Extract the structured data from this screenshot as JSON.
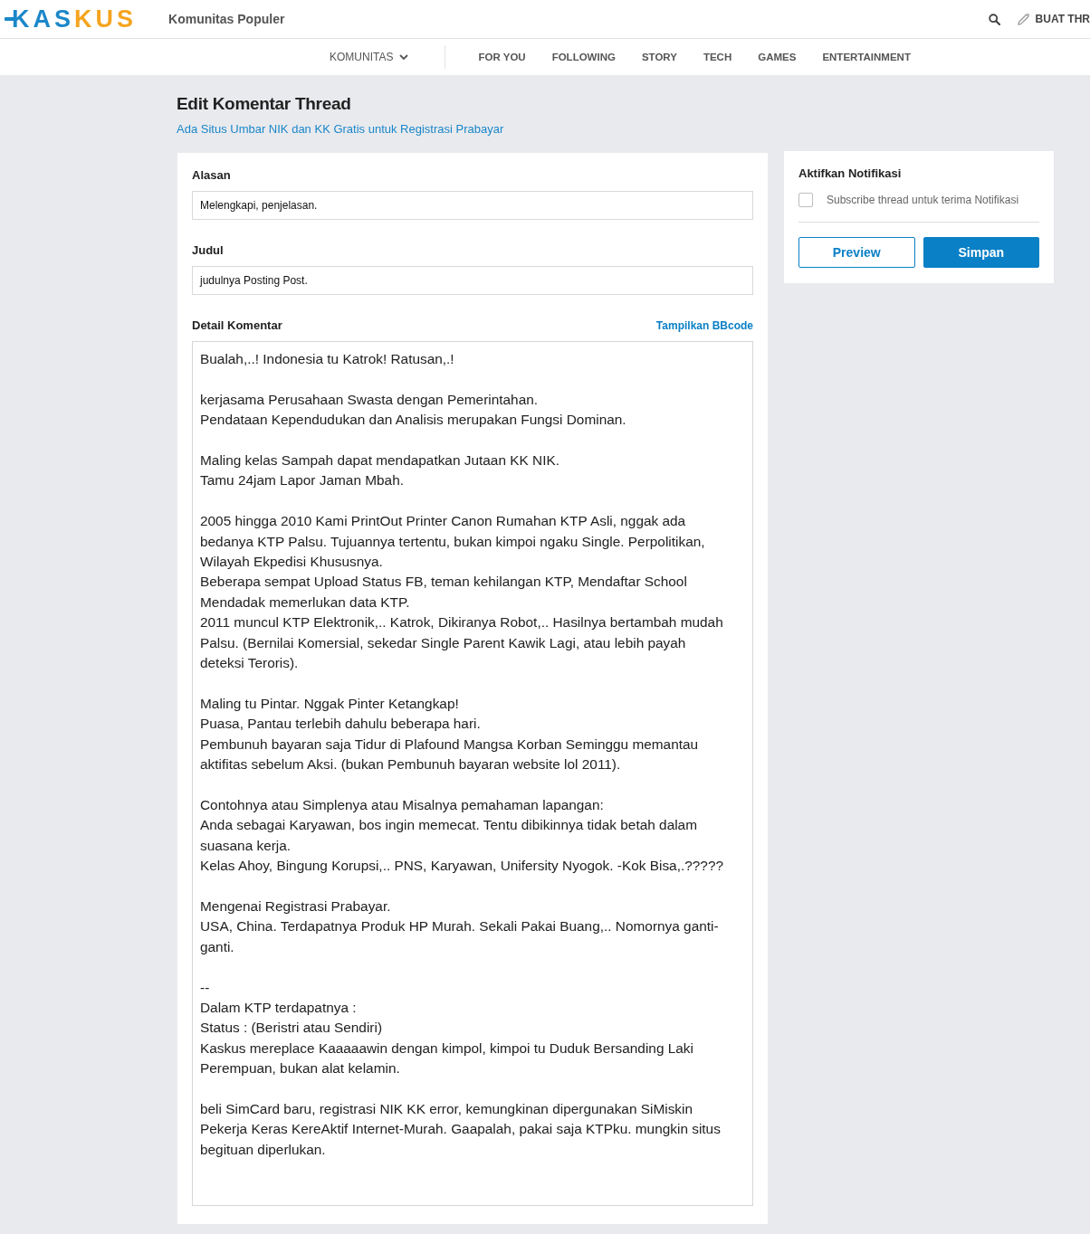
{
  "header": {
    "logo": {
      "text": "KASKUS"
    },
    "section_title": "Komunitas Populer",
    "create_button": {
      "label": "BUAT THR"
    }
  },
  "nav": {
    "community_menu": {
      "label": "KOMUNITAS",
      "expanded": false
    },
    "tabs": [
      {
        "label": "FOR YOU",
        "selected": false
      },
      {
        "label": "FOLLOWING",
        "selected": false
      },
      {
        "label": "STORY",
        "selected": false
      },
      {
        "label": "TECH",
        "selected": false
      },
      {
        "label": "GAMES",
        "selected": false
      },
      {
        "label": "ENTERTAINMENT",
        "selected": false
      }
    ]
  },
  "page": {
    "title": "Edit Komentar Thread",
    "thread_link": "Ada Situs Umbar NIK dan KK Gratis untuk Registrasi Prabayar"
  },
  "form": {
    "fields": [
      {
        "label": "Alasan",
        "value": "Melengkapi, penjelasan."
      },
      {
        "label": "Judul",
        "value": "judulnya Posting Post."
      }
    ],
    "detail": {
      "label": "Detail Komentar",
      "bbcode_link": "Tampilkan BBcode",
      "value": "Bualah,..! Indonesia tu Katrok! Ratusan,.!\n\nkerjasama Perusahaan Swasta dengan Pemerintahan.\nPendataan Kependudukan dan Analisis merupakan Fungsi Dominan.\n\nMaling kelas Sampah dapat mendapatkan Jutaan KK NIK.\nTamu 24jam Lapor Jaman Mbah.\n\n2005 hingga 2010 Kami PrintOut Printer Canon Rumahan KTP Asli, nggak ada bedanya KTP Palsu. Tujuannya tertentu, bukan kimpoi ngaku Single. Perpolitikan, Wilayah Ekpedisi Khususnya.\nBeberapa sempat Upload Status FB, teman kehilangan KTP, Mendaftar School Mendadak memerlukan data KTP.\n2011 muncul KTP Elektronik,.. Katrok, Dikiranya Robot,.. Hasilnya bertambah mudah Palsu. (Bernilai Komersial, sekedar Single Parent Kawik Lagi, atau lebih payah deteksi Teroris).\n\nMaling tu Pintar. Nggak Pinter Ketangkap!\nPuasa, Pantau terlebih dahulu beberapa hari.\nPembunuh bayaran saja Tidur di Plafound Mangsa Korban Seminggu memantau aktifitas sebelum Aksi. (bukan Pembunuh bayaran website lol 2011).\n\nContohnya atau Simplenya atau Misalnya pemahaman lapangan:\nAnda sebagai Karyawan, bos ingin memecat. Tentu dibikinnya tidak betah dalam suasana kerja.\nKelas Ahoy, Bingung Korupsi,.. PNS, Karyawan, Unifersity Nyogok. -Kok Bisa,.?????\n\nMengenai Registrasi Prabayar.\nUSA, China. Terdapatnya Produk HP Murah. Sekali Pakai Buang,.. Nomornya ganti-ganti.\n\n--\nDalam KTP terdapatnya :\nStatus : (Beristri atau Sendiri)\nKaskus mereplace Kaaaaawin dengan kimpol, kimpoi tu Duduk Bersanding Laki Perempuan, bukan alat kelamin.\n\nbeli SimCard baru, registrasi NIK KK error, kemungkinan dipergunakan SiMiskin Pekerja Keras KereAktif Internet-Murah. Gaapalah, pakai saja KTPku. mungkin situs begituan diperlukan."
    }
  },
  "sidebar": {
    "title": "Aktifkan Notifikasi",
    "subscribe": {
      "label": "Subscribe thread untuk terima Notifikasi",
      "checked": false
    },
    "buttons": [
      {
        "label": "Preview",
        "kind": "outline"
      },
      {
        "label": "Simpan",
        "kind": "primary"
      }
    ]
  }
}
